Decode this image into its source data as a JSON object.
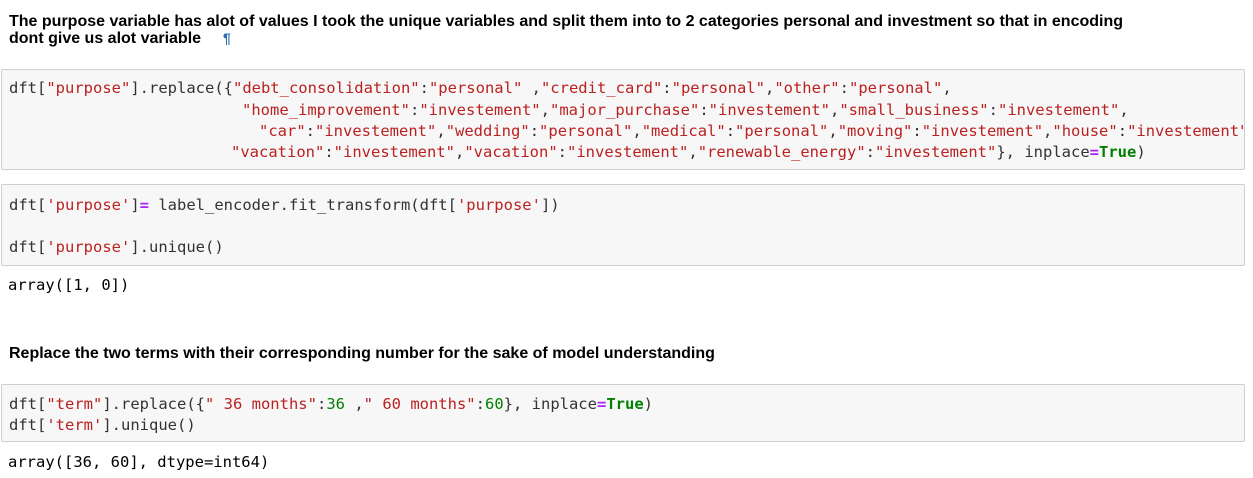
{
  "markdown1": {
    "line1": "The purpose variable has alot of values I took the unique variables and split them into to 2 categories personal and investment so that in encoding",
    "line2": "dont give us alot variable",
    "anchor": "¶"
  },
  "cell1": {
    "l1": [
      "dft[",
      "\"purpose\"",
      "].replace({",
      "\"debt_consolidation\"",
      ":",
      "\"personal\"",
      " ,",
      "\"credit_card\"",
      ":",
      "\"personal\"",
      ",",
      "\"other\"",
      ":",
      "\"personal\"",
      ","
    ],
    "l2": [
      "\"home_improvement\"",
      ":",
      "\"investement\"",
      ",",
      "\"major_purchase\"",
      ":",
      "\"investement\"",
      ",",
      "\"small_business\"",
      ":",
      "\"investement\"",
      ","
    ],
    "l3": [
      "\"car\"",
      ":",
      "\"investement\"",
      ",",
      "\"wedding\"",
      ":",
      "\"personal\"",
      ",",
      "\"medical\"",
      ":",
      "\"personal\"",
      ",",
      "\"moving\"",
      ":",
      "\"investement\"",
      ",",
      "\"house\"",
      ":",
      "\"investement\""
    ],
    "l4": [
      "\"vacation\"",
      ":",
      "\"investement\"",
      ",",
      "\"vacation\"",
      ":",
      "\"investement\"",
      ",",
      "\"renewable_energy\"",
      ":",
      "\"investement\"",
      "}, inplace",
      "=",
      "True",
      ")"
    ]
  },
  "cell2": {
    "l1": [
      "dft[",
      "'purpose'",
      "]",
      "=",
      " label_encoder.fit_transform(dft[",
      "'purpose'",
      "])"
    ],
    "l2": [
      "dft[",
      "'purpose'",
      "].unique()"
    ]
  },
  "output1": "array([1, 0])",
  "markdown2": {
    "text": "Replace the two terms with their corresponding number for the sake of model understanding"
  },
  "cell3": {
    "l1": [
      "dft[",
      "\"term\"",
      "].replace({",
      "\" 36 months\"",
      ":",
      "36",
      " ,",
      "\" 60 months\"",
      ":",
      "60",
      "}, inplace",
      "=",
      "True",
      ")"
    ],
    "l2": [
      "dft[",
      "'term'",
      "].unique()"
    ]
  },
  "output2": "array([36, 60], dtype=int64)"
}
